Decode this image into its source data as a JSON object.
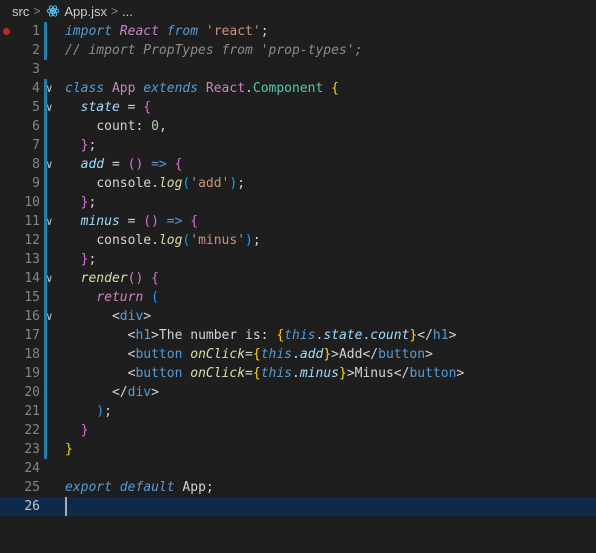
{
  "breadcrumb": {
    "folder": "src",
    "file": "App.jsx",
    "more": "...",
    "react_icon_color": "#4fc3f7"
  },
  "editor": {
    "current_line": 26,
    "breakpoint_line": 1,
    "lines": [
      {
        "n": "1",
        "tokens": [
          [
            "kw2",
            "import"
          ],
          [
            "plain",
            " "
          ],
          [
            "kw",
            "React"
          ],
          [
            "plain",
            " "
          ],
          [
            "kw2",
            "from"
          ],
          [
            "plain",
            " "
          ],
          [
            "str",
            "'react'"
          ],
          [
            "plain",
            ";"
          ]
        ]
      },
      {
        "n": "2",
        "tokens": [
          [
            "cmt",
            "// import PropTypes from 'prop-types';"
          ]
        ]
      },
      {
        "n": "3",
        "tokens": []
      },
      {
        "n": "4",
        "tokens": [
          [
            "kw2",
            "class"
          ],
          [
            "plain",
            " "
          ],
          [
            "cls",
            "App"
          ],
          [
            "plain",
            " "
          ],
          [
            "kw2",
            "extends"
          ],
          [
            "plain",
            " "
          ],
          [
            "cls",
            "React"
          ],
          [
            "plain",
            "."
          ],
          [
            "type",
            "Component"
          ],
          [
            "plain",
            " "
          ],
          [
            "brk1",
            "{"
          ]
        ]
      },
      {
        "n": "5",
        "tokens": [
          [
            "plain",
            "  "
          ],
          [
            "prop",
            "state"
          ],
          [
            "plain",
            " = "
          ],
          [
            "brk2",
            "{"
          ]
        ]
      },
      {
        "n": "6",
        "tokens": [
          [
            "plain",
            "    "
          ],
          [
            "id",
            "count"
          ],
          [
            "plain",
            ": "
          ],
          [
            "num",
            "0"
          ],
          [
            "plain",
            ","
          ]
        ]
      },
      {
        "n": "7",
        "tokens": [
          [
            "plain",
            "  "
          ],
          [
            "brk2",
            "}"
          ],
          [
            "plain",
            ";"
          ]
        ]
      },
      {
        "n": "8",
        "tokens": [
          [
            "plain",
            "  "
          ],
          [
            "prop",
            "add"
          ],
          [
            "plain",
            " = "
          ],
          [
            "brk2",
            "()"
          ],
          [
            "plain",
            " "
          ],
          [
            "kw2",
            "=>"
          ],
          [
            "plain",
            " "
          ],
          [
            "brk2",
            "{"
          ]
        ]
      },
      {
        "n": "9",
        "tokens": [
          [
            "plain",
            "    "
          ],
          [
            "plain",
            "console"
          ],
          [
            "plain",
            "."
          ],
          [
            "fn",
            "log"
          ],
          [
            "brk3",
            "("
          ],
          [
            "str",
            "'add'"
          ],
          [
            "brk3",
            ")"
          ],
          [
            "plain",
            ";"
          ]
        ]
      },
      {
        "n": "10",
        "tokens": [
          [
            "plain",
            "  "
          ],
          [
            "brk2",
            "}"
          ],
          [
            "plain",
            ";"
          ]
        ]
      },
      {
        "n": "11",
        "tokens": [
          [
            "plain",
            "  "
          ],
          [
            "prop",
            "minus"
          ],
          [
            "plain",
            " = "
          ],
          [
            "brk2",
            "()"
          ],
          [
            "plain",
            " "
          ],
          [
            "kw2",
            "=>"
          ],
          [
            "plain",
            " "
          ],
          [
            "brk2",
            "{"
          ]
        ]
      },
      {
        "n": "12",
        "tokens": [
          [
            "plain",
            "    "
          ],
          [
            "plain",
            "console"
          ],
          [
            "plain",
            "."
          ],
          [
            "fn",
            "log"
          ],
          [
            "brk3",
            "("
          ],
          [
            "str",
            "'minus'"
          ],
          [
            "brk3",
            ")"
          ],
          [
            "plain",
            ";"
          ]
        ]
      },
      {
        "n": "13",
        "tokens": [
          [
            "plain",
            "  "
          ],
          [
            "brk2",
            "}"
          ],
          [
            "plain",
            ";"
          ]
        ]
      },
      {
        "n": "14",
        "tokens": [
          [
            "plain",
            "  "
          ],
          [
            "fn",
            "render"
          ],
          [
            "brk2",
            "()"
          ],
          [
            "plain",
            " "
          ],
          [
            "brk2",
            "{"
          ]
        ]
      },
      {
        "n": "15",
        "tokens": [
          [
            "plain",
            "    "
          ],
          [
            "kw",
            "return"
          ],
          [
            "plain",
            " "
          ],
          [
            "brk3",
            "("
          ]
        ]
      },
      {
        "n": "16",
        "tokens": [
          [
            "plain",
            "      "
          ],
          [
            "plain",
            "<"
          ],
          [
            "tag",
            "div"
          ],
          [
            "plain",
            ">"
          ]
        ]
      },
      {
        "n": "17",
        "tokens": [
          [
            "plain",
            "        "
          ],
          [
            "plain",
            "<"
          ],
          [
            "tag",
            "h1"
          ],
          [
            "plain",
            ">The number is: "
          ],
          [
            "brk1",
            "{"
          ],
          [
            "this",
            "this"
          ],
          [
            "plain",
            "."
          ],
          [
            "prop",
            "state"
          ],
          [
            "plain",
            "."
          ],
          [
            "prop",
            "count"
          ],
          [
            "brk1",
            "}"
          ],
          [
            "plain",
            "</"
          ],
          [
            "tag",
            "h1"
          ],
          [
            "plain",
            ">"
          ]
        ]
      },
      {
        "n": "18",
        "tokens": [
          [
            "plain",
            "        "
          ],
          [
            "plain",
            "<"
          ],
          [
            "tag",
            "button"
          ],
          [
            "plain",
            " "
          ],
          [
            "fn",
            "onClick"
          ],
          [
            "plain",
            "="
          ],
          [
            "brk1",
            "{"
          ],
          [
            "this",
            "this"
          ],
          [
            "plain",
            "."
          ],
          [
            "prop",
            "add"
          ],
          [
            "brk1",
            "}"
          ],
          [
            "plain",
            ">Add</"
          ],
          [
            "tag",
            "button"
          ],
          [
            "plain",
            ">"
          ]
        ]
      },
      {
        "n": "19",
        "tokens": [
          [
            "plain",
            "        "
          ],
          [
            "plain",
            "<"
          ],
          [
            "tag",
            "button"
          ],
          [
            "plain",
            " "
          ],
          [
            "fn",
            "onClick"
          ],
          [
            "plain",
            "="
          ],
          [
            "brk1",
            "{"
          ],
          [
            "this",
            "this"
          ],
          [
            "plain",
            "."
          ],
          [
            "prop",
            "minus"
          ],
          [
            "brk1",
            "}"
          ],
          [
            "plain",
            ">Minus</"
          ],
          [
            "tag",
            "button"
          ],
          [
            "plain",
            ">"
          ]
        ]
      },
      {
        "n": "20",
        "tokens": [
          [
            "plain",
            "      "
          ],
          [
            "plain",
            "</"
          ],
          [
            "tag",
            "div"
          ],
          [
            "plain",
            ">"
          ]
        ]
      },
      {
        "n": "21",
        "tokens": [
          [
            "plain",
            "    "
          ],
          [
            "brk3",
            ")"
          ],
          [
            "plain",
            ";"
          ]
        ]
      },
      {
        "n": "22",
        "tokens": [
          [
            "plain",
            "  "
          ],
          [
            "brk2",
            "}"
          ]
        ]
      },
      {
        "n": "23",
        "tokens": [
          [
            "brk1",
            "}"
          ]
        ]
      },
      {
        "n": "24",
        "tokens": []
      },
      {
        "n": "25",
        "tokens": [
          [
            "kw2",
            "export"
          ],
          [
            "plain",
            " "
          ],
          [
            "kw2",
            "default"
          ],
          [
            "plain",
            " App;"
          ]
        ]
      },
      {
        "n": "26",
        "tokens": []
      }
    ],
    "foldable_lines": [
      "4",
      "5",
      "8",
      "11",
      "14",
      "16"
    ]
  }
}
